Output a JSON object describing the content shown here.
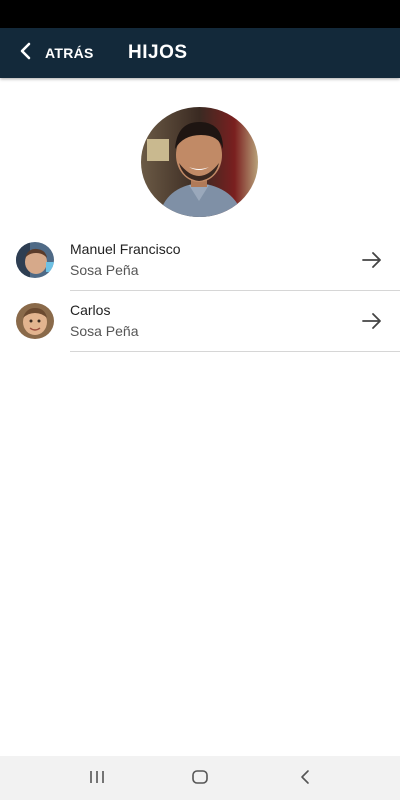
{
  "header": {
    "back_label": "ATRÁS",
    "title": "HIJOS"
  },
  "parent": {
    "photo_icon": "person-photo"
  },
  "children": [
    {
      "first_name": "Manuel Francisco",
      "last_name": "Sosa Peña",
      "avatar_icon": "child-photo",
      "action_icon": "arrow-right-icon"
    },
    {
      "first_name": "Carlos",
      "last_name": "Sosa Peña",
      "avatar_icon": "child-photo",
      "action_icon": "arrow-right-icon"
    }
  ],
  "system_nav": {
    "recents_icon": "recents-icon",
    "home_icon": "home-icon",
    "back_icon": "system-back-icon"
  },
  "colors": {
    "app_bar": "#13293a",
    "status_bar": "#000000",
    "divider": "#d6d6d6",
    "nav_bar": "#f2f2f2"
  }
}
